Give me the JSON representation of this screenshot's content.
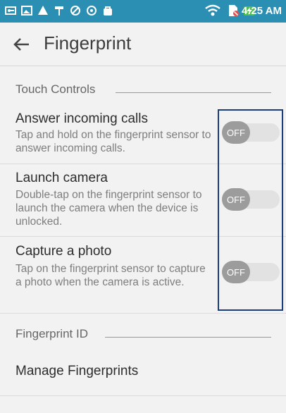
{
  "status_bar": {
    "time": "4:25 AM",
    "icons": [
      "vpn-key-icon",
      "image-icon",
      "triangle-app-icon",
      "paint-roller-icon",
      "sync-icon",
      "compass-icon",
      "bag-icon",
      "wifi-icon",
      "no-sim-icon",
      "battery-charging-icon"
    ],
    "background": "#2a8fb3"
  },
  "app_bar": {
    "title": "Fingerprint",
    "back_icon": "arrow-back-icon"
  },
  "sections": {
    "touch_controls": {
      "header": "Touch Controls",
      "items": [
        {
          "title": "Answer incoming calls",
          "description": "Tap and hold on the fingerprint sensor to answer incoming calls.",
          "toggle": "OFF"
        },
        {
          "title": "Launch camera",
          "description": "Double-tap on the fingerprint sensor to launch the camera when the device is unlocked.",
          "toggle": "OFF"
        },
        {
          "title": "Capture a photo",
          "description": "Tap on the fingerprint sensor to capture a photo when the camera is active.",
          "toggle": "OFF"
        }
      ]
    },
    "fingerprint_id": {
      "header": "Fingerprint ID",
      "items": [
        {
          "title": "Manage Fingerprints"
        }
      ]
    }
  },
  "colors": {
    "highlight_box": "#1b3d7e",
    "toggle_off_thumb": "#9c9c9c",
    "toggle_off_track": "#e2e2e2"
  }
}
